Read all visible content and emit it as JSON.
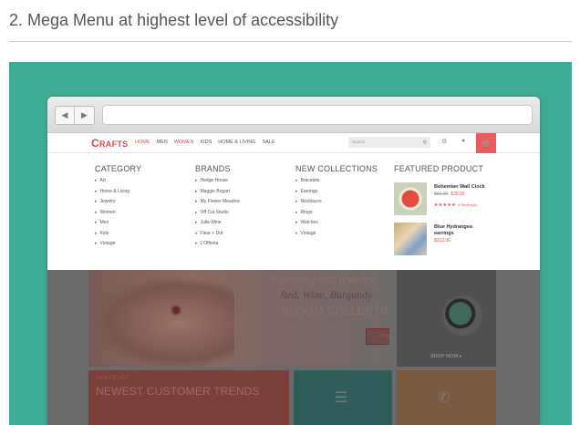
{
  "page": {
    "heading": "2. Mega Menu at highest level of accessibility"
  },
  "site": {
    "logo": "CRAFTS",
    "nav": [
      "HOME",
      "MEN",
      "WOMEN",
      "KIDS",
      "HOME & LIVING",
      "SALE"
    ],
    "active_nav": [
      "HOME",
      "WOMEN"
    ],
    "search_placeholder": "Search",
    "icons": [
      "search-icon",
      "gear-icon",
      "user-icon",
      "cart-icon"
    ],
    "accent_color": "#e0474c",
    "cart_color": "#e95b5f"
  },
  "mega_menu": {
    "columns": [
      {
        "title": "CATEGORY",
        "items": [
          "Art",
          "Home & Living",
          "Jewelry",
          "Women",
          "Men",
          "Kids",
          "Vintage"
        ]
      },
      {
        "title": "BRANDS",
        "items": [
          "Hedge House",
          "Maggie Bogart",
          "My Flower Meadow",
          "Off Cut Studio",
          "Julia Wine",
          "Fleur + Dot",
          "L'Offiona"
        ]
      },
      {
        "title": "NEW COLLECTIONS",
        "items": [
          "Bracelets",
          "Earrings",
          "Necklaces",
          "Rings",
          "Watches",
          "Vintage"
        ]
      }
    ],
    "featured": {
      "title": "FEATURED PRODUCT",
      "products": [
        {
          "name": "Bohemian Wall Clock",
          "old_price": "$56.00",
          "price": "$39.00",
          "stars": "★★★★★",
          "reviews": "4 Review(s)"
        },
        {
          "name": "Blue Hydrangea",
          "name_line2": "earrings",
          "price": "$212.00"
        }
      ]
    }
  },
  "content": {
    "hero_line1": "Flowers petal jewelry",
    "hero_line2": "Red, Wine, Burgundy",
    "hero_line3": "BLOOM COLLECTION",
    "hero_button": "SHOP NOW",
    "hero_dots": "●●●●",
    "side_button": "SHOP NOW ▸",
    "tile_kicker": "WHAT'S HOT",
    "tile_title": "NEWEST CUSTOMER TRENDS",
    "teal_color": "#3fac95"
  }
}
